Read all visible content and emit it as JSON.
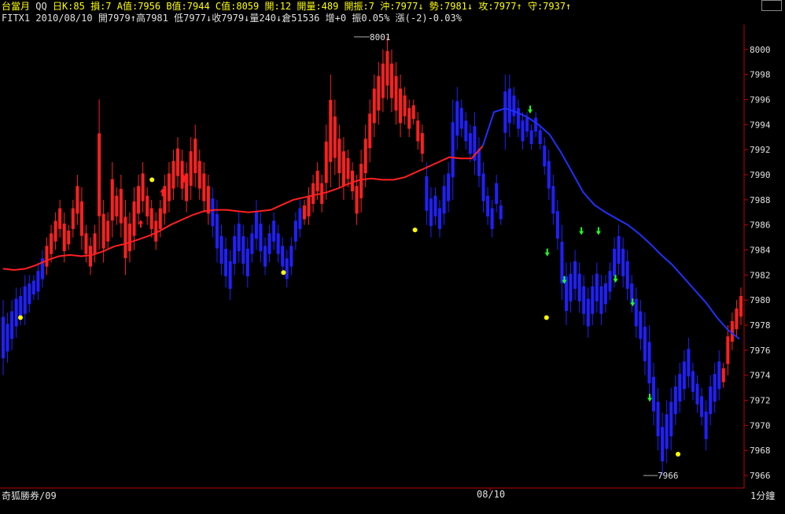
{
  "header": {
    "row1": {
      "title": "台當月",
      "qq": "QQ",
      "items": [
        "日K:85",
        "損:7",
        "A值:7956",
        "B值:7944",
        "C值:8059",
        "開:12",
        "開量:489",
        "開振:7",
        "沖:7977↓",
        "勢:7981↓",
        "攻:7977↑",
        "守:7937↑"
      ]
    },
    "row2": {
      "symbol": "FITX1",
      "date": "2010/08/10",
      "open": "開7979↑",
      "high": "高7981",
      "low": "低7977↓",
      "close": "收7979↓",
      "volume": "量240↓",
      "oi": "倉51536",
      "oi_change": "增+0",
      "amplitude": "振0.05%",
      "change": "漲(-2)-0.03%"
    }
  },
  "footer": {
    "brand": "奇狐勝券/09",
    "date_label": "08/10",
    "interval": "1分鐘"
  },
  "annotations": {
    "high_label": "8001",
    "low_label": "7966"
  },
  "colors": {
    "background": "#000000",
    "axis": "#c00000",
    "up_bar": "#ff2020",
    "down_bar": "#2020ff",
    "ma_up": "#ff2020",
    "ma_down": "#2030ff",
    "tick_text": "#e0e0e0",
    "header_text": "#ffff00",
    "signal_dot": "#ffff00",
    "sell_arrow": "#20ff20",
    "buy_arrow": "#ff2020"
  },
  "chart_data": {
    "type": "line",
    "subtype": "1-minute high-low bars with moving average",
    "ylim": [
      7965,
      8002
    ],
    "yticks": [
      8000,
      7998,
      7996,
      7994,
      7992,
      7990,
      7988,
      7986,
      7984,
      7982,
      7980,
      7978,
      7976,
      7974,
      7972,
      7970,
      7968,
      7966
    ],
    "x_label": "08/10",
    "bars": [
      {
        "lo": 7974,
        "hi": 7980,
        "c": "d"
      },
      {
        "lo": 7975,
        "hi": 7979,
        "c": "d"
      },
      {
        "lo": 7976,
        "hi": 7980,
        "c": "d"
      },
      {
        "lo": 7977,
        "hi": 7981,
        "c": "d"
      },
      {
        "lo": 7978,
        "hi": 7981,
        "c": "d"
      },
      {
        "lo": 7978,
        "hi": 7982,
        "c": "d"
      },
      {
        "lo": 7979,
        "hi": 7982,
        "c": "d"
      },
      {
        "lo": 7980,
        "hi": 7982,
        "c": "d"
      },
      {
        "lo": 7980,
        "hi": 7983,
        "c": "d"
      },
      {
        "lo": 7981,
        "hi": 7984,
        "c": "d"
      },
      {
        "lo": 7982,
        "hi": 7985,
        "c": "u"
      },
      {
        "lo": 7983,
        "hi": 7986,
        "c": "u"
      },
      {
        "lo": 7984,
        "hi": 7987,
        "c": "u"
      },
      {
        "lo": 7985,
        "hi": 7988,
        "c": "u"
      },
      {
        "lo": 7983,
        "hi": 7987,
        "c": "u"
      },
      {
        "lo": 7984,
        "hi": 7986,
        "c": "u"
      },
      {
        "lo": 7985,
        "hi": 7988,
        "c": "u"
      },
      {
        "lo": 7986,
        "hi": 7990,
        "c": "u"
      },
      {
        "lo": 7984,
        "hi": 7989,
        "c": "u"
      },
      {
        "lo": 7983,
        "hi": 7986,
        "c": "u"
      },
      {
        "lo": 7982,
        "hi": 7985,
        "c": "u"
      },
      {
        "lo": 7983,
        "hi": 7986,
        "c": "u"
      },
      {
        "lo": 7984,
        "hi": 7996,
        "c": "u"
      },
      {
        "lo": 7983,
        "hi": 7988,
        "c": "u"
      },
      {
        "lo": 7984,
        "hi": 7987,
        "c": "u"
      },
      {
        "lo": 7985,
        "hi": 7991,
        "c": "u"
      },
      {
        "lo": 7986,
        "hi": 7989,
        "c": "u"
      },
      {
        "lo": 7985,
        "hi": 7990,
        "c": "u"
      },
      {
        "lo": 7982,
        "hi": 7988,
        "c": "u"
      },
      {
        "lo": 7983,
        "hi": 7987,
        "c": "u"
      },
      {
        "lo": 7984,
        "hi": 7989,
        "c": "u"
      },
      {
        "lo": 7986,
        "hi": 7990,
        "c": "u"
      },
      {
        "lo": 7987,
        "hi": 7991,
        "c": "u"
      },
      {
        "lo": 7986,
        "hi": 7989,
        "c": "u"
      },
      {
        "lo": 7985,
        "hi": 7988,
        "c": "u"
      },
      {
        "lo": 7984,
        "hi": 7987,
        "c": "u"
      },
      {
        "lo": 7985,
        "hi": 7988,
        "c": "u"
      },
      {
        "lo": 7986,
        "hi": 7990,
        "c": "u"
      },
      {
        "lo": 7987,
        "hi": 7991,
        "c": "u"
      },
      {
        "lo": 7988,
        "hi": 7992,
        "c": "u"
      },
      {
        "lo": 7989,
        "hi": 7993,
        "c": "u"
      },
      {
        "lo": 7988,
        "hi": 7992,
        "c": "u"
      },
      {
        "lo": 7987,
        "hi": 7991,
        "c": "u"
      },
      {
        "lo": 7988,
        "hi": 7993,
        "c": "u"
      },
      {
        "lo": 7989,
        "hi": 7994,
        "c": "u"
      },
      {
        "lo": 7988,
        "hi": 7992,
        "c": "u"
      },
      {
        "lo": 7987,
        "hi": 7991,
        "c": "u"
      },
      {
        "lo": 7986,
        "hi": 7990,
        "c": "u"
      },
      {
        "lo": 7985,
        "hi": 7989,
        "c": "d"
      },
      {
        "lo": 7983,
        "hi": 7988,
        "c": "d"
      },
      {
        "lo": 7982,
        "hi": 7986,
        "c": "d"
      },
      {
        "lo": 7981,
        "hi": 7985,
        "c": "d"
      },
      {
        "lo": 7980,
        "hi": 7984,
        "c": "d"
      },
      {
        "lo": 7982,
        "hi": 7986,
        "c": "d"
      },
      {
        "lo": 7983,
        "hi": 7987,
        "c": "d"
      },
      {
        "lo": 7982,
        "hi": 7986,
        "c": "d"
      },
      {
        "lo": 7981,
        "hi": 7985,
        "c": "d"
      },
      {
        "lo": 7983,
        "hi": 7986,
        "c": "d"
      },
      {
        "lo": 7984,
        "hi": 7988,
        "c": "d"
      },
      {
        "lo": 7983,
        "hi": 7987,
        "c": "d"
      },
      {
        "lo": 7982,
        "hi": 7985,
        "c": "d"
      },
      {
        "lo": 7983,
        "hi": 7986,
        "c": "d"
      },
      {
        "lo": 7984,
        "hi": 7987,
        "c": "d"
      },
      {
        "lo": 7983,
        "hi": 7986,
        "c": "d"
      },
      {
        "lo": 7982,
        "hi": 7985,
        "c": "d"
      },
      {
        "lo": 7981,
        "hi": 7984,
        "c": "d"
      },
      {
        "lo": 7982,
        "hi": 7985,
        "c": "d"
      },
      {
        "lo": 7984,
        "hi": 7987,
        "c": "d"
      },
      {
        "lo": 7985,
        "hi": 7988,
        "c": "d"
      },
      {
        "lo": 7986,
        "hi": 7988,
        "c": "u"
      },
      {
        "lo": 7986,
        "hi": 7989,
        "c": "u"
      },
      {
        "lo": 7987,
        "hi": 7990,
        "c": "u"
      },
      {
        "lo": 7988,
        "hi": 7991,
        "c": "u"
      },
      {
        "lo": 7987,
        "hi": 7990,
        "c": "u"
      },
      {
        "lo": 7988,
        "hi": 7994,
        "c": "u"
      },
      {
        "lo": 7989,
        "hi": 7998,
        "c": "u"
      },
      {
        "lo": 7990,
        "hi": 7996,
        "c": "u"
      },
      {
        "lo": 7989,
        "hi": 7994,
        "c": "u"
      },
      {
        "lo": 7988,
        "hi": 7993,
        "c": "u"
      },
      {
        "lo": 7989,
        "hi": 7992,
        "c": "u"
      },
      {
        "lo": 7988,
        "hi": 7991,
        "c": "u"
      },
      {
        "lo": 7986,
        "hi": 7990,
        "c": "u"
      },
      {
        "lo": 7987,
        "hi": 7992,
        "c": "u"
      },
      {
        "lo": 7989,
        "hi": 7994,
        "c": "u"
      },
      {
        "lo": 7991,
        "hi": 7996,
        "c": "u"
      },
      {
        "lo": 7993,
        "hi": 7998,
        "c": "u"
      },
      {
        "lo": 7994,
        "hi": 7999,
        "c": "u"
      },
      {
        "lo": 7995,
        "hi": 8000,
        "c": "u"
      },
      {
        "lo": 7996,
        "hi": 8001,
        "c": "u"
      },
      {
        "lo": 7995,
        "hi": 8000,
        "c": "u"
      },
      {
        "lo": 7994,
        "hi": 7999,
        "c": "u"
      },
      {
        "lo": 7993,
        "hi": 7998,
        "c": "u"
      },
      {
        "lo": 7994,
        "hi": 7997,
        "c": "u"
      },
      {
        "lo": 7993,
        "hi": 7996,
        "c": "u"
      },
      {
        "lo": 7994,
        "hi": 7996,
        "c": "u"
      },
      {
        "lo": 7992,
        "hi": 7995,
        "c": "u"
      },
      {
        "lo": 7991,
        "hi": 7994,
        "c": "u"
      },
      {
        "lo": 7986,
        "hi": 7991,
        "c": "d"
      },
      {
        "lo": 7985,
        "hi": 7989,
        "c": "d"
      },
      {
        "lo": 7986,
        "hi": 7989,
        "c": "d"
      },
      {
        "lo": 7985,
        "hi": 7988,
        "c": "d"
      },
      {
        "lo": 7986,
        "hi": 7990,
        "c": "d"
      },
      {
        "lo": 7987,
        "hi": 7991,
        "c": "d"
      },
      {
        "lo": 7988,
        "hi": 7996,
        "c": "d"
      },
      {
        "lo": 7992,
        "hi": 7997,
        "c": "d"
      },
      {
        "lo": 7993,
        "hi": 7996,
        "c": "d"
      },
      {
        "lo": 7992,
        "hi": 7995,
        "c": "d"
      },
      {
        "lo": 7991,
        "hi": 7994,
        "c": "d"
      },
      {
        "lo": 7990,
        "hi": 7995,
        "c": "d"
      },
      {
        "lo": 7989,
        "hi": 7993,
        "c": "d"
      },
      {
        "lo": 7987,
        "hi": 7991,
        "c": "d"
      },
      {
        "lo": 7986,
        "hi": 7989,
        "c": "d"
      },
      {
        "lo": 7985,
        "hi": 7988,
        "c": "d"
      },
      {
        "lo": 7987,
        "hi": 7990,
        "c": "d"
      },
      {
        "lo": 7986,
        "hi": 7988,
        "c": "d"
      },
      {
        "lo": 7992,
        "hi": 7998,
        "c": "d"
      },
      {
        "lo": 7993,
        "hi": 7998,
        "c": "d"
      },
      {
        "lo": 7994,
        "hi": 7997,
        "c": "d"
      },
      {
        "lo": 7993,
        "hi": 7996,
        "c": "d"
      },
      {
        "lo": 7992,
        "hi": 7995,
        "c": "d"
      },
      {
        "lo": 7993,
        "hi": 7995,
        "c": "d"
      },
      {
        "lo": 7992,
        "hi": 7994,
        "c": "d"
      },
      {
        "lo": 7993,
        "hi": 7995,
        "c": "d"
      },
      {
        "lo": 7992,
        "hi": 7994,
        "c": "d"
      },
      {
        "lo": 7990,
        "hi": 7993,
        "c": "d"
      },
      {
        "lo": 7988,
        "hi": 7992,
        "c": "d"
      },
      {
        "lo": 7986,
        "hi": 7990,
        "c": "d"
      },
      {
        "lo": 7984,
        "hi": 7988,
        "c": "d"
      },
      {
        "lo": 7980,
        "hi": 7986,
        "c": "d"
      },
      {
        "lo": 7978,
        "hi": 7983,
        "c": "d"
      },
      {
        "lo": 7979,
        "hi": 7983,
        "c": "d"
      },
      {
        "lo": 7980,
        "hi": 7984,
        "c": "d"
      },
      {
        "lo": 7979,
        "hi": 7983,
        "c": "d"
      },
      {
        "lo": 7978,
        "hi": 7982,
        "c": "d"
      },
      {
        "lo": 7977,
        "hi": 7981,
        "c": "d"
      },
      {
        "lo": 7978,
        "hi": 7982,
        "c": "d"
      },
      {
        "lo": 7979,
        "hi": 7983,
        "c": "d"
      },
      {
        "lo": 7978,
        "hi": 7982,
        "c": "d"
      },
      {
        "lo": 7979,
        "hi": 7982,
        "c": "d"
      },
      {
        "lo": 7980,
        "hi": 7983,
        "c": "d"
      },
      {
        "lo": 7981,
        "hi": 7985,
        "c": "d"
      },
      {
        "lo": 7982,
        "hi": 7986,
        "c": "d"
      },
      {
        "lo": 7981,
        "hi": 7985,
        "c": "d"
      },
      {
        "lo": 7980,
        "hi": 7984,
        "c": "d"
      },
      {
        "lo": 7979,
        "hi": 7982,
        "c": "d"
      },
      {
        "lo": 7977,
        "hi": 7981,
        "c": "d"
      },
      {
        "lo": 7976,
        "hi": 7980,
        "c": "d"
      },
      {
        "lo": 7974,
        "hi": 7979,
        "c": "d"
      },
      {
        "lo": 7972,
        "hi": 7978,
        "c": "d"
      },
      {
        "lo": 7970,
        "hi": 7975,
        "c": "d"
      },
      {
        "lo": 7968,
        "hi": 7973,
        "c": "d"
      },
      {
        "lo": 7966,
        "hi": 7971,
        "c": "d"
      },
      {
        "lo": 7967,
        "hi": 7972,
        "c": "d"
      },
      {
        "lo": 7968,
        "hi": 7973,
        "c": "d"
      },
      {
        "lo": 7970,
        "hi": 7974,
        "c": "d"
      },
      {
        "lo": 7971,
        "hi": 7975,
        "c": "d"
      },
      {
        "lo": 7972,
        "hi": 7976,
        "c": "d"
      },
      {
        "lo": 7973,
        "hi": 7977,
        "c": "d"
      },
      {
        "lo": 7972,
        "hi": 7975,
        "c": "d"
      },
      {
        "lo": 7971,
        "hi": 7974,
        "c": "d"
      },
      {
        "lo": 7970,
        "hi": 7973,
        "c": "d"
      },
      {
        "lo": 7968,
        "hi": 7972,
        "c": "d"
      },
      {
        "lo": 7970,
        "hi": 7974,
        "c": "d"
      },
      {
        "lo": 7971,
        "hi": 7975,
        "c": "d"
      },
      {
        "lo": 7972,
        "hi": 7976,
        "c": "d"
      },
      {
        "lo": 7973,
        "hi": 7975,
        "c": "u"
      },
      {
        "lo": 7974,
        "hi": 7978,
        "c": "u"
      },
      {
        "lo": 7976,
        "hi": 7979,
        "c": "u"
      },
      {
        "lo": 7977,
        "hi": 7980,
        "c": "u"
      },
      {
        "lo": 7978,
        "hi": 7981,
        "c": "u"
      }
    ],
    "ma": [
      7982.5,
      7982.4,
      7982.5,
      7982.8,
      7983.2,
      7983.5,
      7983.6,
      7983.5,
      7983.6,
      7983.9,
      7984.3,
      7984.5,
      7984.8,
      7985.1,
      7985.5,
      7986.0,
      7986.4,
      7986.8,
      7987.1,
      7987.2,
      7987.2,
      7987.1,
      7987.0,
      7987.1,
      7987.2,
      7987.6,
      7988.0,
      7988.2,
      7988.4,
      7988.6,
      7988.9,
      7989.3,
      7989.6,
      7989.7,
      7989.6,
      7989.6,
      7989.8,
      7990.2,
      7990.6,
      7991.0,
      7991.4,
      7991.3,
      7991.3,
      7992.3,
      7995.0,
      7995.3,
      7995.0,
      7994.6,
      7994.0,
      7993.2,
      7991.8,
      7990.2,
      7988.6,
      7987.6,
      7987.0,
      7986.5,
      7986.0,
      7985.3,
      7984.5,
      7983.6,
      7982.8,
      7981.8,
      7980.8,
      7979.8,
      7978.6,
      7977.6,
      7976.9
    ],
    "ma_color_switch_index": 43,
    "signal_dots": [
      7978.6,
      7989.6,
      7982.2,
      7985.6,
      7978.6,
      7967.7
    ],
    "sell_arrows": [
      7995.2,
      7983.8,
      7981.6,
      7985.5,
      7985.5,
      7981.7,
      7979.8,
      7972.2
    ],
    "buy_arrows": [
      7986.1,
      7988.6,
      7989.7
    ]
  }
}
